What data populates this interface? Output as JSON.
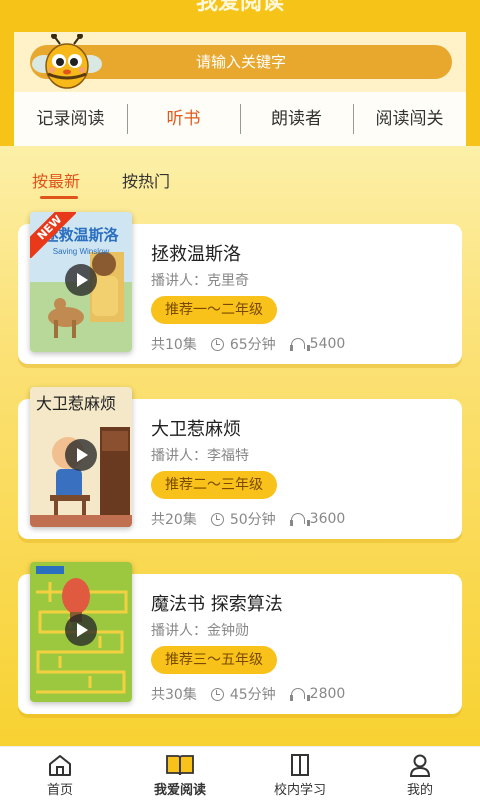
{
  "header": {
    "title": "我爱阅读",
    "search_placeholder": "请输入关键字",
    "tabs": [
      {
        "label": "记录阅读",
        "active": false
      },
      {
        "label": "听书",
        "active": true
      },
      {
        "label": "朗读者",
        "active": false
      },
      {
        "label": "阅读闯关",
        "active": false
      }
    ]
  },
  "sort_tabs": [
    {
      "label": "按最新",
      "active": true
    },
    {
      "label": "按热门",
      "active": false
    }
  ],
  "books": [
    {
      "title": "拯救温斯洛",
      "narrator": "播讲人：克里奇",
      "grade": "推荐一～二年级",
      "episodes": "共10集",
      "duration": "65分钟",
      "plays": "5400",
      "cover_text": "拯救温斯洛",
      "cover_subtext": "Saving Winslow",
      "badge": "NEW"
    },
    {
      "title": "大卫惹麻烦",
      "narrator": "播讲人：李福特",
      "grade": "推荐二～三年级",
      "episodes": "共20集",
      "duration": "50分钟",
      "plays": "3600",
      "cover_text": "大卫惹麻烦"
    },
    {
      "title": "魔法书 探索算法",
      "narrator": "播讲人：金钟勋",
      "grade": "推荐三～五年级",
      "episodes": "共30集",
      "duration": "45分钟",
      "plays": "2800"
    }
  ],
  "bottom_nav": [
    {
      "label": "首页",
      "icon": "home-icon",
      "active": false
    },
    {
      "label": "我爱阅读",
      "icon": "open-book-icon",
      "active": true
    },
    {
      "label": "校内学习",
      "icon": "book-icon",
      "active": false
    },
    {
      "label": "我的",
      "icon": "user-icon",
      "active": false
    }
  ],
  "colors": {
    "brand_yellow": "#f6c418",
    "accent_orange": "#e05a1c",
    "grade_pill": "#f8c21a"
  }
}
